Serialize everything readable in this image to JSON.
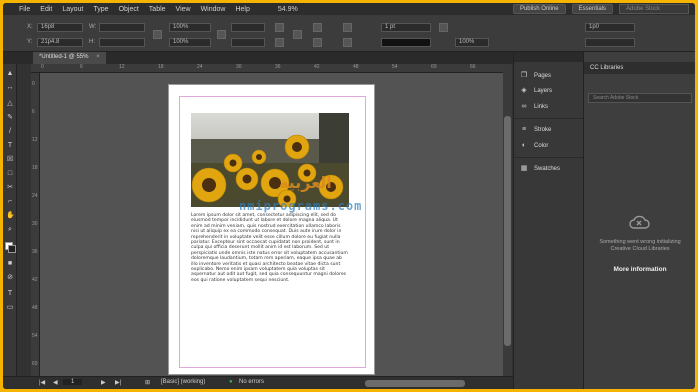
{
  "menu": {
    "items": [
      "File",
      "Edit",
      "Layout",
      "Type",
      "Object",
      "Table",
      "View",
      "Window",
      "Help"
    ],
    "zoom": "54.9%",
    "publish_label": "Publish Online",
    "workspace": "Essentials",
    "search_placeholder": "Adobe Stock"
  },
  "control": {
    "x_label": "X:",
    "x_value": "16p8",
    "y_label": "Y:",
    "y_value": "21p4.8",
    "w_label": "W:",
    "h_label": "H:",
    "stroke_weight": "1 pt",
    "opacity": "100%",
    "field_value": "1p0",
    "percent_a": "100%",
    "percent_b": "100%"
  },
  "tabbar": {
    "doc_tab": "*Untitled-1 @ 55%",
    "close_glyph": "×"
  },
  "ruler": {
    "h": [
      "0",
      "6",
      "12",
      "18",
      "24",
      "30",
      "36",
      "42",
      "48",
      "54",
      "60",
      "66"
    ],
    "v": [
      "0",
      "6",
      "12",
      "18",
      "24",
      "30",
      "36",
      "42",
      "48",
      "54",
      "60"
    ]
  },
  "document": {
    "body_text": "Lorem ipsum dolor sit amet, consectetur adipiscing elit, sed do eiusmod tempor incididunt ut labore et dolore magna aliqua. Ut enim ad minim veniam, quis nostrud exercitation ullamco laboris nisi ut aliquip ex ea commodo consequat. Duis aute irure dolor in reprehenderit in voluptate velit esse cillum dolore eu fugiat nulla pariatur. Excepteur sint occaecat cupidatat non proident, sunt in culpa qui officia deserunt mollit anim id est laborum. Sed ut perspiciatis unde omnis iste natus error sit voluptatem accusantium doloremque laudantium, totam rem aperiam, eaque ipsa quae ab illo inventore veritatis et quasi architecto beatae vitae dicta sunt explicabo. Nemo enim ipsam voluptatem quia voluptas sit aspernatur aut odit aut fugit, sed quia consequuntur magni dolores eos qui ratione voluptatem sequi nesciunt.",
    "watermark_ar": "العربية",
    "watermark_url": "nmiprograms.com"
  },
  "status": {
    "page_number": "1",
    "style": "[Basic] (working)",
    "errors": "No errors"
  },
  "panels": {
    "items": [
      {
        "label": "Pages",
        "icon": "pages-icon"
      },
      {
        "label": "Layers",
        "icon": "layers-icon"
      },
      {
        "label": "Links",
        "icon": "links-icon"
      },
      {
        "label": "Stroke",
        "icon": "stroke-icon"
      },
      {
        "label": "Color",
        "icon": "color-icon"
      },
      {
        "label": "Swatches",
        "icon": "swatches-icon"
      }
    ]
  },
  "cc": {
    "title": "CC Libraries",
    "search_placeholder": "Search Adobe Stock",
    "error_line1": "Something went wrong initializing",
    "error_line2": "Creative Cloud Libraries",
    "more_info": "More information"
  },
  "colors": {
    "frame": "#f4b400",
    "ui_dark": "#323232",
    "pasteboard": "#535353",
    "accent_status": "#3fb24f"
  }
}
